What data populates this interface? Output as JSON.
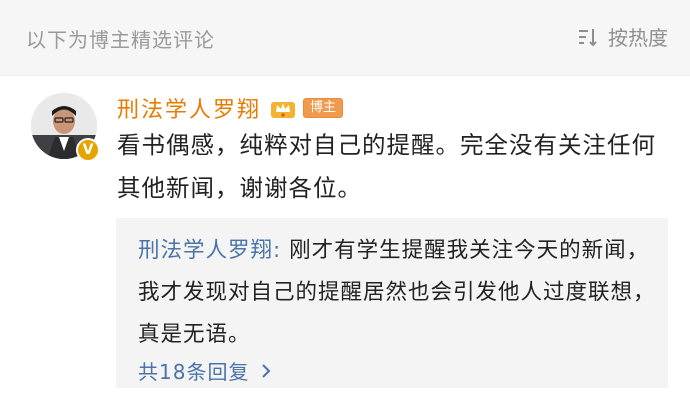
{
  "header": {
    "section_label": "以下为博主精选评论",
    "sort_label": "按热度"
  },
  "comment": {
    "author": "刑法学人罗翔",
    "author_badge": "博主",
    "avatar_badge": "V",
    "text": "看书偶感，纯粹对自己的提醒。完全没有关注任何其他新闻，谢谢各位。",
    "reply": {
      "author": "刑法学人罗翔",
      "separator": ": ",
      "text": "刚才有学生提醒我关注今天的新闻，我才发现对自己的提醒居然也会引发他人过度联想，真是无语。",
      "count_label": "共18条回复"
    }
  },
  "colors": {
    "author": "#e77b00",
    "reply_link": "#4a73a8",
    "verified_badge": "#e6a400"
  },
  "icons": {
    "sort": "sort-icon",
    "crown": "crown-icon",
    "chevron": "chevron-right-icon"
  }
}
